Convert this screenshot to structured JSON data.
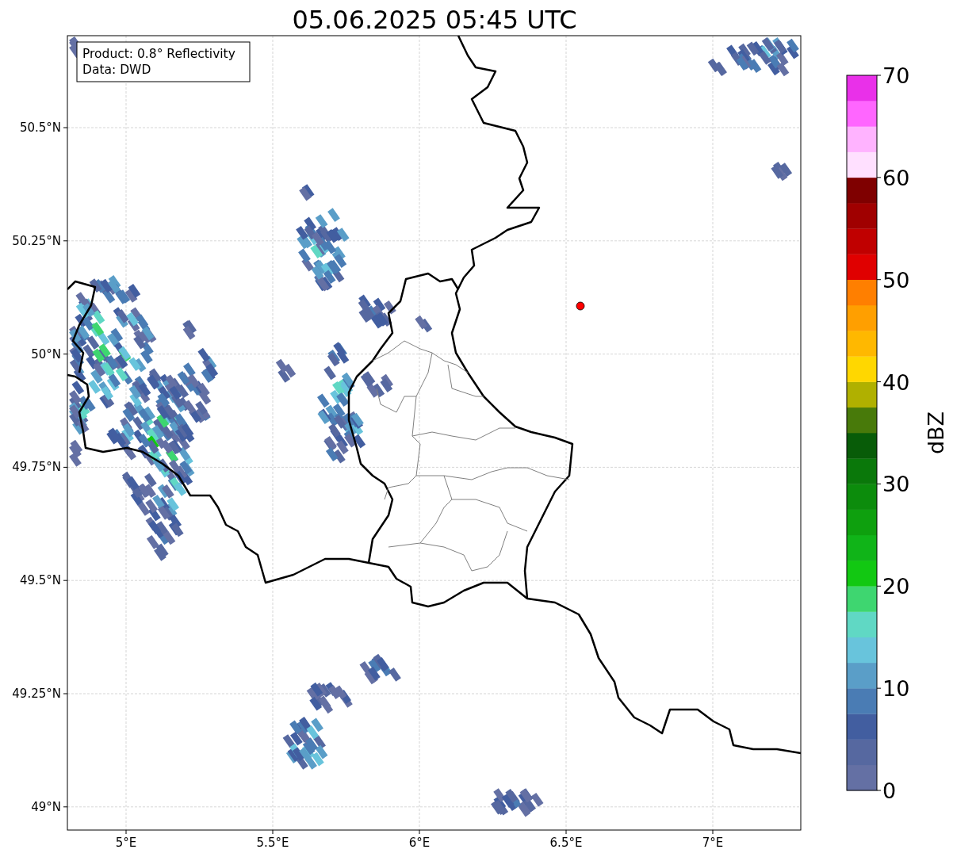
{
  "title": "05.06.2025 05:45 UTC",
  "info_box": [
    "Product: 0.8° Reflectivity",
    "Data: DWD"
  ],
  "x_ticks": [
    "5°E",
    "5.5°E",
    "6°E",
    "6.5°E",
    "7°E"
  ],
  "y_ticks": [
    "50.5°N",
    "50.25°N",
    "50°N",
    "49.75°N",
    "49.5°N",
    "49.25°N",
    "49°N"
  ],
  "colorbar": {
    "label": "dBZ",
    "ticks": [
      "70",
      "60",
      "50",
      "40",
      "30",
      "20",
      "10",
      "0"
    ],
    "bins": [
      {
        "color": "#6470a4"
      },
      {
        "color": "#5668a0"
      },
      {
        "color": "#425ea0"
      },
      {
        "color": "#4a7cb4"
      },
      {
        "color": "#5a9ec8"
      },
      {
        "color": "#68c4dc"
      },
      {
        "color": "#60d8c4"
      },
      {
        "color": "#3ed670"
      },
      {
        "color": "#12c812"
      },
      {
        "color": "#10b418"
      },
      {
        "color": "#0ea00e"
      },
      {
        "color": "#0c8c0c"
      },
      {
        "color": "#0a780a"
      },
      {
        "color": "#085c08"
      },
      {
        "color": "#487a0a"
      },
      {
        "color": "#b0b000"
      },
      {
        "color": "#ffd700"
      },
      {
        "color": "#ffb800"
      },
      {
        "color": "#ff9f00"
      },
      {
        "color": "#ff7f00"
      },
      {
        "color": "#e00000"
      },
      {
        "color": "#c00000"
      },
      {
        "color": "#a00000"
      },
      {
        "color": "#7f0000"
      },
      {
        "color": "#ffe0ff"
      },
      {
        "color": "#ffb3ff"
      },
      {
        "color": "#ff66ff"
      },
      {
        "color": "#e930e9"
      }
    ]
  }
}
